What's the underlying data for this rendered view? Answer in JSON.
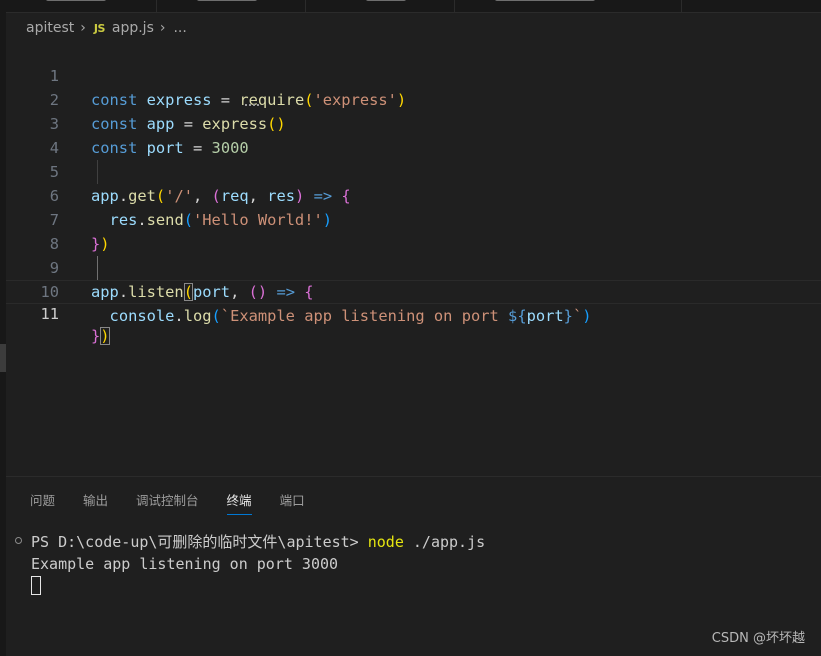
{
  "breadcrumb": {
    "folder": "apitest",
    "file_badge": "JS",
    "file": "app.js",
    "more": "..."
  },
  "editor": {
    "active_line": 11,
    "line_numbers": [
      "1",
      "2",
      "3",
      "4",
      "5",
      "6",
      "7",
      "8",
      "9",
      "10",
      "11"
    ]
  },
  "panel": {
    "tabs": [
      "问题",
      "输出",
      "调试控制台",
      "终端",
      "端口"
    ],
    "active_tab": "终端"
  },
  "terminal": {
    "prompt": "PS D:\\code-up\\可删除的临时文件\\apitest> ",
    "command": "node",
    "args": " ./app.js",
    "output": "Example app listening on port 3000"
  },
  "watermark": "CSDN @坏坏越",
  "colors": {
    "keyword": "#569cd6",
    "variable": "#9cdcfe",
    "function": "#dcdcaa",
    "string": "#ce9178",
    "number": "#b5cea8",
    "bracket1": "#ffd700",
    "bracket2": "#da70d6",
    "bracket3": "#179fff",
    "terminal_command": "#e5e510",
    "panel_tab_underline": "#0078d4"
  }
}
